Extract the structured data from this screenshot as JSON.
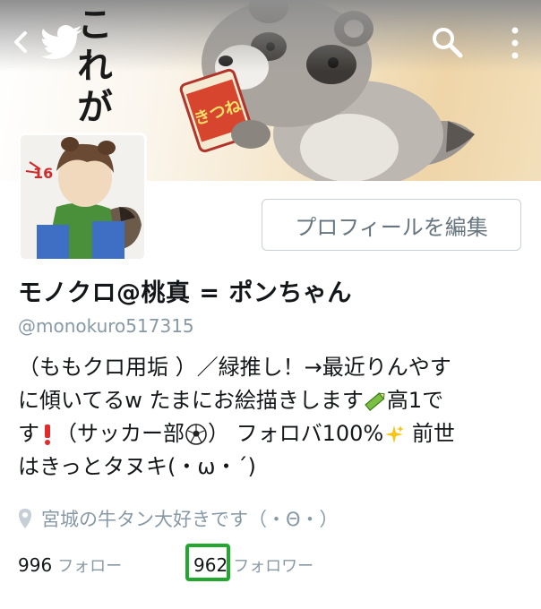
{
  "banner": {
    "script_text": "これがい"
  },
  "nav": {
    "back_icon": "chevron-left-icon",
    "logo_icon": "twitter-bird-icon",
    "search_icon": "search-icon",
    "more_icon": "more-vertical-icon"
  },
  "profile": {
    "edit_button_label": "プロフィールを編集",
    "display_name": "モノクロ@桃真 = ポンちゃん",
    "handle": "@monokuro517315",
    "bio": {
      "line1": "（ももクロ用垢 ）／緑推し！→最近りんやす",
      "line2_a": "に傾いてるw たまにお絵描きします",
      "line2_b": "高1で",
      "line3_a": "す",
      "line3_b": "（サッカー部",
      "line3_c": "） フォロバ100%",
      "line3_d": " 前世",
      "line4": "はきっとタヌキ(・ω・´)"
    },
    "location": "宮城の牛タン大好きです（・Θ・）",
    "following_count": "996",
    "following_label": "フォロー",
    "followers_count": "962",
    "followers_label": "フォロワー"
  },
  "colors": {
    "text_primary": "#14171a",
    "text_secondary": "#8899a6",
    "border": "#c9d0d6",
    "highlight": "#21a82d"
  }
}
